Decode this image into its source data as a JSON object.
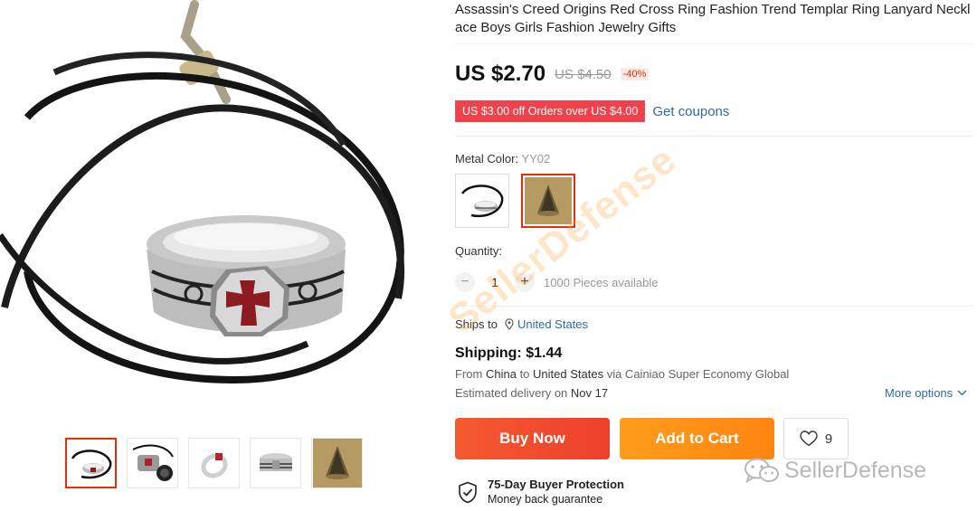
{
  "product": {
    "title": "Assassin's Creed Origins Red Cross Ring Fashion Trend Templar Ring Lanyard Necklace Boys Girls Fashion Jewelry Gifts",
    "price": "US $2.70",
    "old_price": "US $4.50",
    "discount": "-40%"
  },
  "coupon": {
    "text": "US $3.00 off Orders over US $4.00",
    "link": "Get coupons",
    "color": "#f1414a"
  },
  "variant": {
    "label": "Metal Color:",
    "selected": "YY02",
    "options": [
      "necklace-with-ring",
      "bronze-hood-pendant"
    ]
  },
  "quantity": {
    "label": "Quantity:",
    "value": "1",
    "minus": "−",
    "plus": "+",
    "available": "1000 Pieces available"
  },
  "shipping": {
    "ships_to_label": "Ships to",
    "ships_to_country": "United States",
    "title": "Shipping: $1.44",
    "from_prefix": "From",
    "from_country": "China",
    "to_word": "to",
    "to_country": "United States",
    "via_text": "via Cainiao Super Economy Global",
    "est_prefix": "Estimated delivery on",
    "est_date": "Nov 17",
    "more_options": "More options"
  },
  "actions": {
    "buy_now": "Buy Now",
    "add_to_cart": "Add to Cart",
    "wishlist_count": "9"
  },
  "protection": {
    "title": "75-Day Buyer Protection",
    "subtitle": "Money back guarantee"
  },
  "watermark": {
    "brand": "SellerDefense",
    "diagonal": "SellerDefense"
  },
  "thumbnails": [
    "ring-on-cord",
    "ring-and-case",
    "ring-red-cross",
    "ring-side-view",
    "bronze-hood-pendant"
  ],
  "colors": {
    "accent_red": "#e62e04",
    "link_blue": "#2e6aa8",
    "buy_orange_red": "#f4502f",
    "cart_orange": "#ff9416"
  }
}
